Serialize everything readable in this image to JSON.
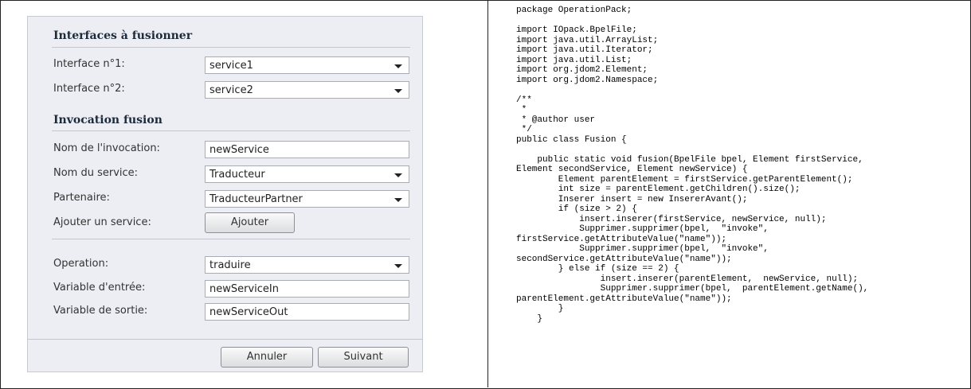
{
  "dialog": {
    "section1_title": "Interfaces à fusionner",
    "interface1_label": "Interface n°1:",
    "interface1_value": "service1",
    "interface2_label": "Interface n°2:",
    "interface2_value": "service2",
    "section2_title": "Invocation fusion",
    "invocation_label": "Nom de l'invocation:",
    "invocation_value": "newService",
    "service_label": "Nom du service:",
    "service_value": "Traducteur",
    "partner_label": "Partenaire:",
    "partner_value": "TraducteurPartner",
    "add_service_label": "Ajouter un service:",
    "add_button": "Ajouter",
    "operation_label": "Operation:",
    "operation_value": "traduire",
    "input_var_label": "Variable d'entrée:",
    "input_var_value": "newServiceIn",
    "output_var_label": "Variable de sortie:",
    "output_var_value": "newServiceOut",
    "cancel_button": "Annuler",
    "next_button": "Suivant"
  },
  "code": {
    "lines": [
      "package OperationPack;",
      "",
      "import IOpack.BpelFile;",
      "import java.util.ArrayList;",
      "import java.util.Iterator;",
      "import java.util.List;",
      "import org.jdom2.Element;",
      "import org.jdom2.Namespace;",
      "",
      "/**",
      " *",
      " * @author user",
      " */",
      "public class Fusion {",
      "",
      "    public static void fusion(BpelFile bpel, Element firstService,",
      "Element secondService, Element newService) {",
      "        Element parentElement = firstService.getParentElement();",
      "        int size = parentElement.getChildren().size();",
      "        Inserer insert = new InsererAvant();",
      "        if (size > 2) {",
      "            insert.inserer(firstService, newService, null);",
      "            Supprimer.supprimer(bpel,  \"invoke\",",
      "firstService.getAttributeValue(\"name\"));",
      "            Supprimer.supprimer(bpel,  \"invoke\",",
      "secondService.getAttributeValue(\"name\"));",
      "        } else if (size == 2) {",
      "                insert.inserer(parentElement,  newService, null);",
      "                Supprimer.supprimer(bpel,  parentElement.getName(),",
      "parentElement.getAttributeValue(\"name\"));",
      "        }",
      "    }"
    ]
  }
}
